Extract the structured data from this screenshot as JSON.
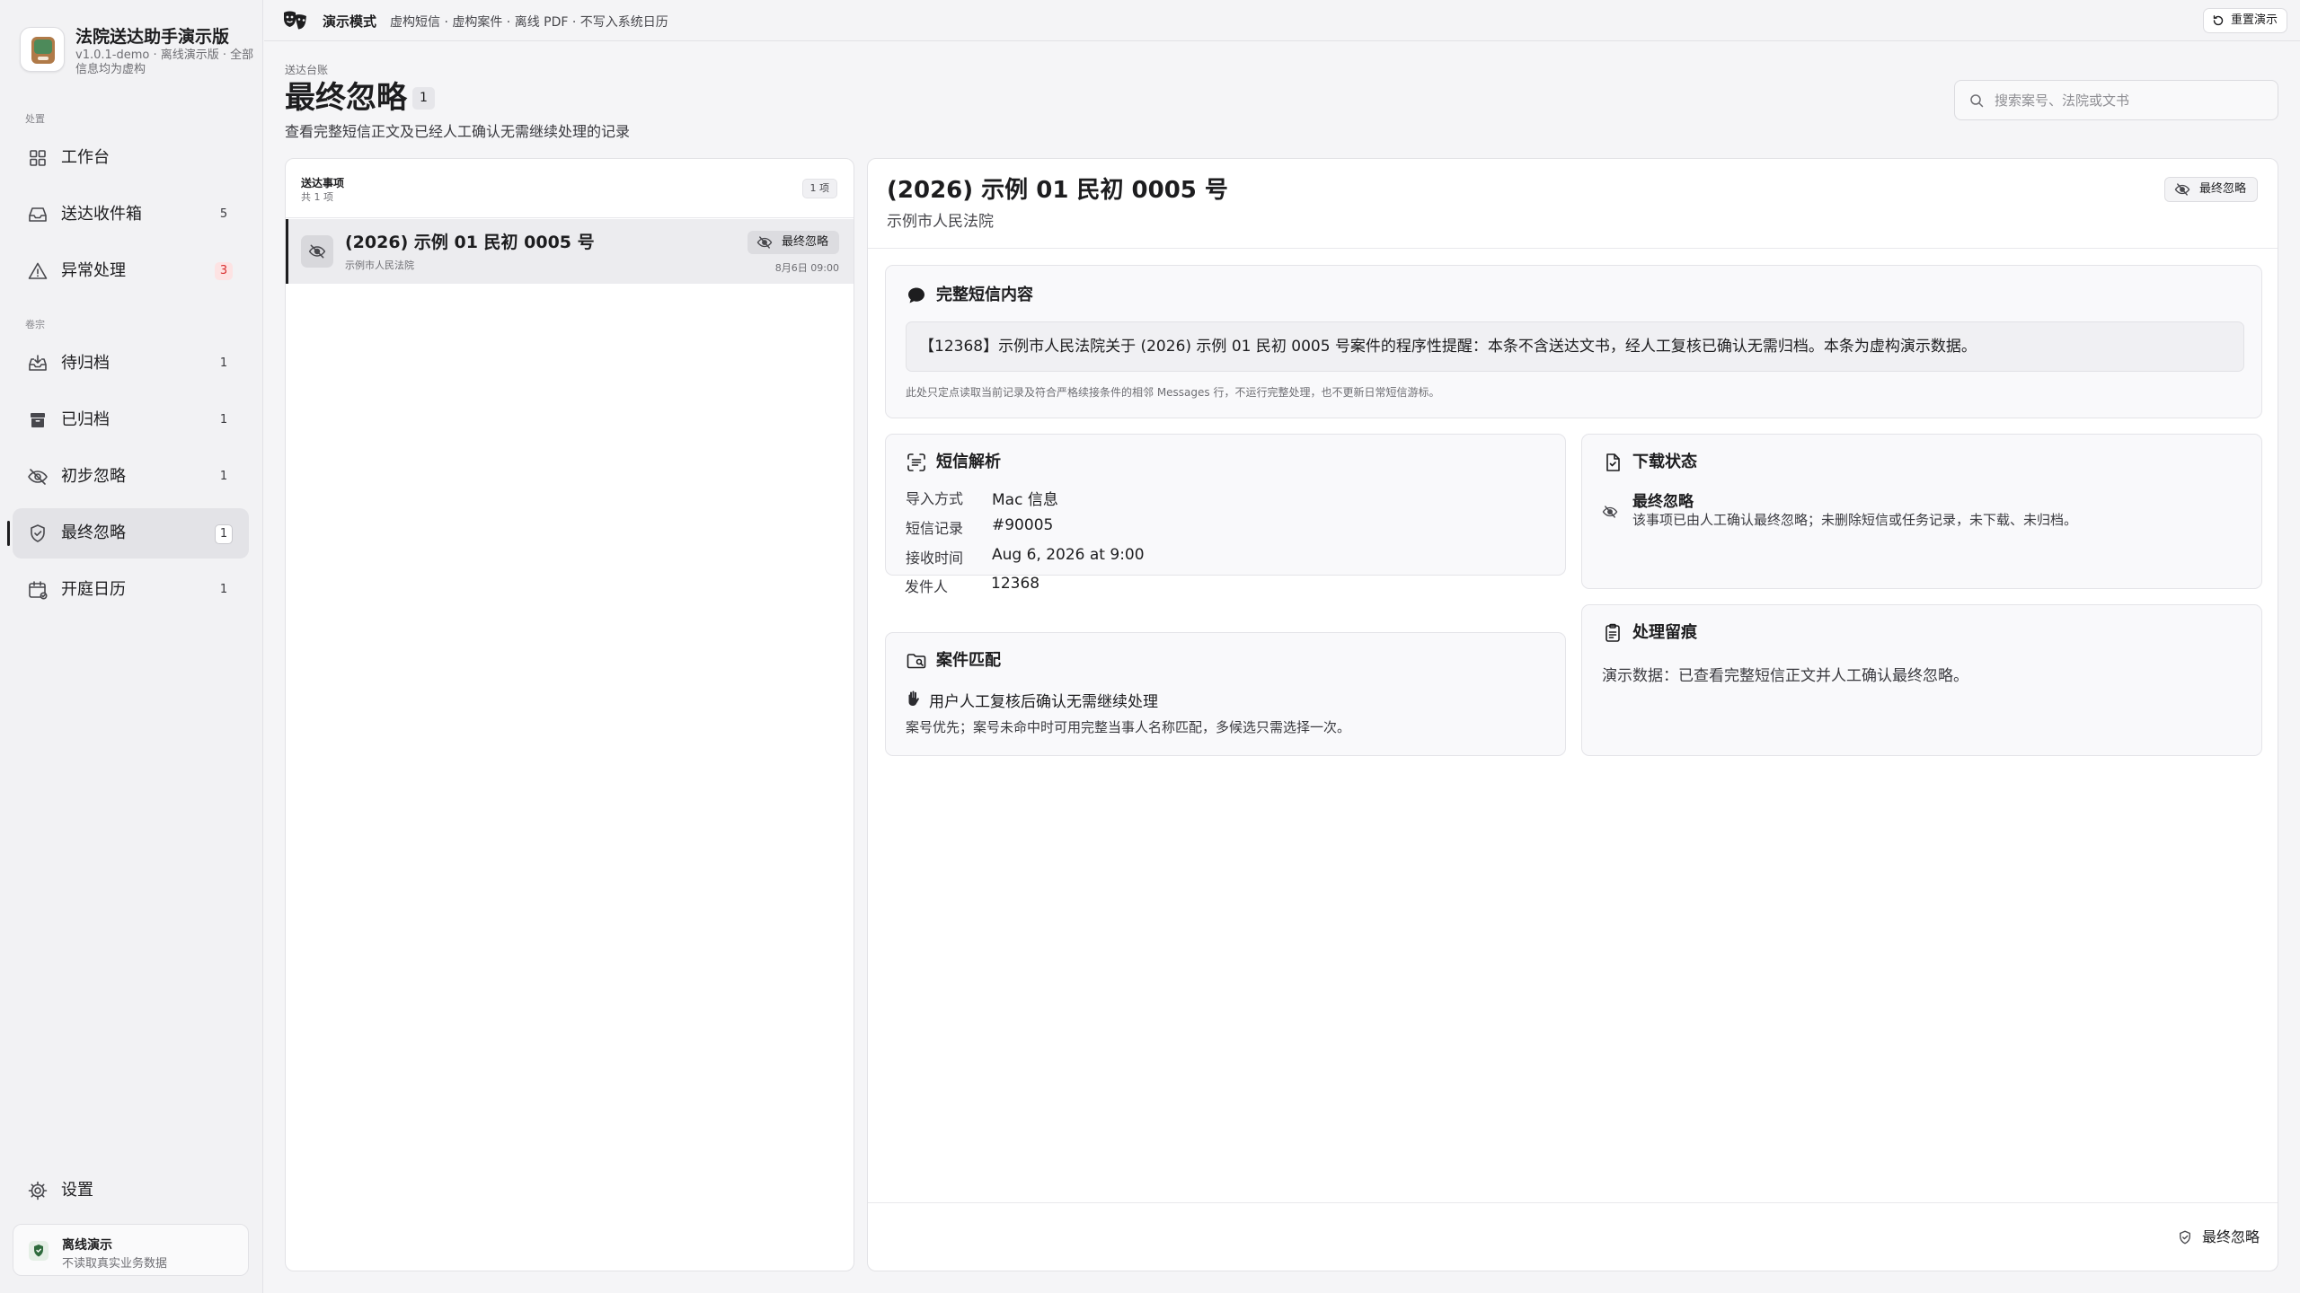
{
  "brand": {
    "title": "法院送达助手演示版",
    "subtitle": "v1.0.1-demo · 离线演示版 · 全部信息均为虚构"
  },
  "sidebar": {
    "section_process": "处置",
    "section_archive": "卷宗",
    "items": [
      {
        "label": "工作台",
        "count": "",
        "icon": "grid-icon"
      },
      {
        "label": "送达收件箱",
        "count": "5",
        "icon": "inbox-icon"
      },
      {
        "label": "异常处理",
        "count": "3",
        "icon": "warning-icon"
      },
      {
        "label": "待归档",
        "count": "1",
        "icon": "tray-icon"
      },
      {
        "label": "已归档",
        "count": "1",
        "icon": "archive-icon"
      },
      {
        "label": "初步忽略",
        "count": "1",
        "icon": "eye-slash-icon"
      },
      {
        "label": "最终忽略",
        "count": "1",
        "icon": "shield-check-icon"
      },
      {
        "label": "开庭日历",
        "count": "1",
        "icon": "calendar-icon"
      }
    ],
    "settings_label": "设置",
    "offline": {
      "title": "离线演示",
      "subtitle": "不读取真实业务数据"
    }
  },
  "topbar": {
    "mode": "演示模式",
    "description": "虚构短信 · 虚构案件 · 离线 PDF · 不写入系统日历",
    "reset_label": "重置演示"
  },
  "header": {
    "breadcrumb": "送达台账",
    "title": "最终忽略",
    "count": "1",
    "description": "查看完整短信正文及已经人工确认无需继续处理的记录"
  },
  "search": {
    "placeholder": "搜索案号、法院或文书"
  },
  "list": {
    "title": "送达事项",
    "subtitle": "共 1 项",
    "badge": "1 项",
    "rows": [
      {
        "case": "(2026) 示例 01 民初 0005 号",
        "court": "示例市人民法院",
        "tag": "最终忽略",
        "time": "8月6日 09:00"
      }
    ]
  },
  "detail": {
    "title": "(2026) 示例 01 民初 0005 号",
    "court": "示例市人民法院",
    "tag": "最终忽略",
    "sms": {
      "title": "完整短信内容",
      "content": "【12368】示例市人民法院关于 (2026) 示例 01 民初 0005 号案件的程序性提醒：本条不含送达文书，经人工复核已确认无需归档。本条为虚构演示数据。",
      "note": "此处只定点读取当前记录及符合严格续接条件的相邻 Messages 行，不运行完整处理，也不更新日常短信游标。"
    },
    "parse": {
      "title": "短信解析",
      "fields": [
        {
          "k": "导入方式",
          "v": "Mac 信息"
        },
        {
          "k": "短信记录",
          "v": "#90005"
        },
        {
          "k": "接收时间",
          "v": "Aug 6, 2026 at 9:00"
        },
        {
          "k": "发件人",
          "v": "12368"
        }
      ]
    },
    "download": {
      "title": "下载状态",
      "status": "最终忽略",
      "desc": "该事项已由人工确认最终忽略；未删除短信或任务记录，未下载、未归档。"
    },
    "match": {
      "title": "案件匹配",
      "line": "用户人工复核后确认无需继续处理",
      "sub": "案号优先；案号未命中时可用完整当事人名称匹配，多候选只需选择一次。"
    },
    "trace": {
      "title": "处理留痕",
      "text": "演示数据：已查看完整短信正文并人工确认最终忽略。"
    },
    "footer_label": "最终忽略"
  }
}
